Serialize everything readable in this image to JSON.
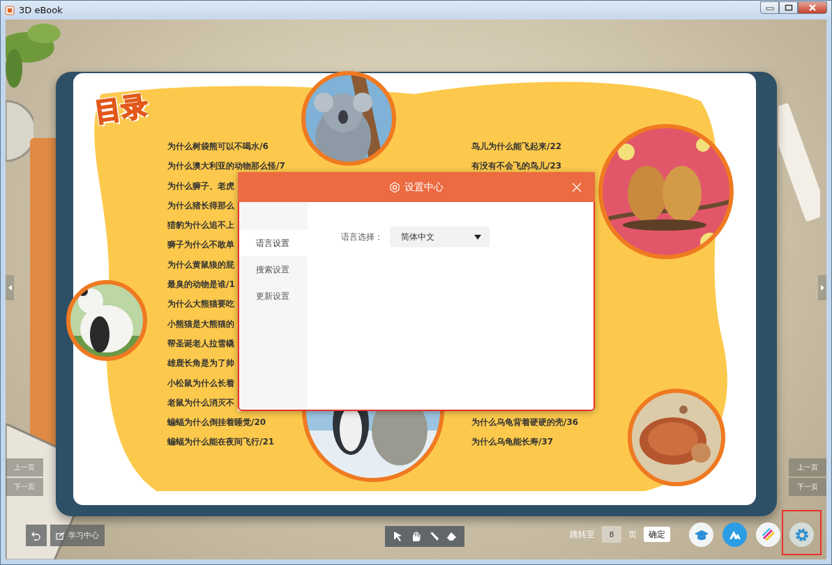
{
  "window": {
    "title": "3D eBook"
  },
  "book": {
    "heading": "目录",
    "left_entries": [
      "为什么树袋熊可以不喝水/6",
      "为什么澳大利亚的动物那么怪/7",
      "为什么狮子、老虎",
      "为什么猪长得那么",
      "猎豹为什么追不上",
      "狮子为什么不敢单",
      "为什么黄鼠狼的屁",
      "最臭的动物是谁/1",
      "为什么大熊猫要吃",
      "小熊猫是大熊猫的",
      "帮圣诞老人拉雪橇",
      "雄鹿长角是为了帅",
      "小松鼠为什么长着",
      "老鼠为什么消灭不",
      "蝙蝠为什么倒挂着睡觉/20",
      "蝙蝠为什么能在夜间飞行/21"
    ],
    "right_top_entries": [
      "鸟儿为什么能飞起来/22",
      "有没有不会飞的鸟儿/23"
    ],
    "right_bottom_entries": [
      "为什么乌龟背着硬硬的壳/36",
      "为什么乌龟能长寿/37"
    ]
  },
  "page_nav": {
    "left": [
      "上一页",
      "下一页"
    ],
    "right": [
      "上一页",
      "下一页"
    ]
  },
  "toolbar": {
    "study_center": "学习中心",
    "tools": [
      {
        "kind": "pointer"
      },
      {
        "kind": "hand"
      },
      {
        "kind": "pen"
      },
      {
        "kind": "eraser"
      }
    ],
    "jump": {
      "label": "跳转至",
      "value": "8",
      "unit": "页",
      "confirm": "确定"
    },
    "apps": [
      {
        "kind": "course",
        "highlighted": false
      },
      {
        "kind": "mountain",
        "highlighted": false
      },
      {
        "kind": "stripes",
        "highlighted": false
      },
      {
        "kind": "settings",
        "highlighted": true
      }
    ]
  },
  "dialog": {
    "title": "设置中心",
    "highlighted": true,
    "tabs": [
      {
        "label": "语言设置",
        "selected": true
      },
      {
        "label": "搜索设置",
        "selected": false
      },
      {
        "label": "更新设置",
        "selected": false
      }
    ],
    "field": {
      "label": "语言选择：",
      "value": "简体中文"
    }
  }
}
